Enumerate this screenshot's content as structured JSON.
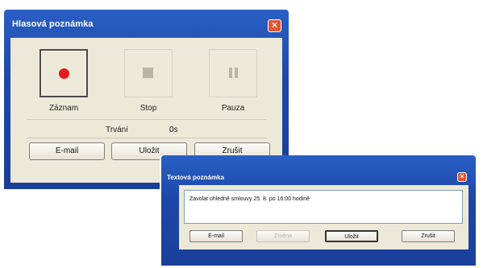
{
  "voice_note": {
    "title": "Hlasová poznámka",
    "close_label": "×",
    "controls": [
      {
        "label": "Záznam",
        "icon": "record-icon"
      },
      {
        "label": "Stop",
        "icon": "stop-icon"
      },
      {
        "label": "Pauza",
        "icon": "pause-icon"
      }
    ],
    "duration_label": "Trvání",
    "duration_value": "0s",
    "buttons": [
      "E-mail",
      "Uložit",
      "Zrušit"
    ]
  },
  "text_note": {
    "title": "Textová poznámka",
    "close_label": "×",
    "text": "Zavolat ohledně smlouvy 25. 8. po 16:00 hodině",
    "buttons": [
      {
        "label": "E-mail",
        "enabled": true
      },
      {
        "label": "Změna",
        "enabled": false
      },
      {
        "label": "Uložit",
        "enabled": true,
        "default": true
      },
      {
        "label": "Zrušit",
        "enabled": true
      }
    ]
  },
  "colors": {
    "titlebar": "#1c47a8",
    "client_bg": "#ece9d8",
    "record_dot": "#e41b1b",
    "close_button": "#e25535"
  }
}
